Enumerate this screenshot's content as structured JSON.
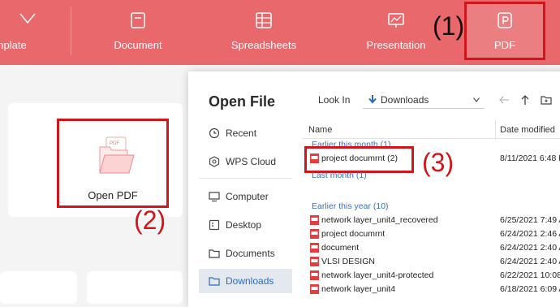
{
  "topbar": {
    "items": [
      {
        "label": "nplate"
      },
      {
        "label": "Document"
      },
      {
        "label": "Spreadsheets"
      },
      {
        "label": "Presentation"
      },
      {
        "label": "PDF"
      }
    ]
  },
  "annotations": {
    "step1": "(1)",
    "step2": "(2)",
    "step3": "(3)"
  },
  "home": {
    "open_pdf_label": "Open PDF",
    "pdf_badge": "PDF"
  },
  "dialog": {
    "title": "Open File",
    "look_in_label": "Look In",
    "look_in_value": "Downloads",
    "sidebar": [
      {
        "label": "Recent",
        "icon": "clock-icon"
      },
      {
        "label": "WPS Cloud",
        "icon": "cloud-icon"
      },
      {
        "label": "Computer",
        "icon": "monitor-icon"
      },
      {
        "label": "Desktop",
        "icon": "desktop-icon"
      },
      {
        "label": "Documents",
        "icon": "folder-icon"
      },
      {
        "label": "Downloads",
        "icon": "folder-icon"
      }
    ],
    "columns": {
      "name": "Name",
      "date": "Date modified"
    },
    "groups": {
      "this_month": "Earlier this month (1)",
      "last_month": "Last month (1)",
      "this_year": "Earlier this year (10)"
    },
    "files_this_month": [
      {
        "name": "project documrnt (2)",
        "date": "8/11/2021 6:48 P"
      }
    ],
    "files_this_year": [
      {
        "name": "network layer_unit4_recovered",
        "date": "6/25/2021 7:49 A"
      },
      {
        "name": "project documrnt",
        "date": "6/24/2021 2:46 A"
      },
      {
        "name": "document",
        "date": "6/24/2021 2:40 A"
      },
      {
        "name": "VLSI DESIGN",
        "date": "6/24/2021 2:40 A"
      },
      {
        "name": "network layer_unit4-protected",
        "date": "6/22/2021 10:08"
      },
      {
        "name": "network layer_unit4",
        "date": "6/18/2021 6:09 A"
      }
    ]
  },
  "colors": {
    "topbar": "#e8686b",
    "highlight": "#d0161b",
    "link_blue": "#3a6fb8"
  }
}
